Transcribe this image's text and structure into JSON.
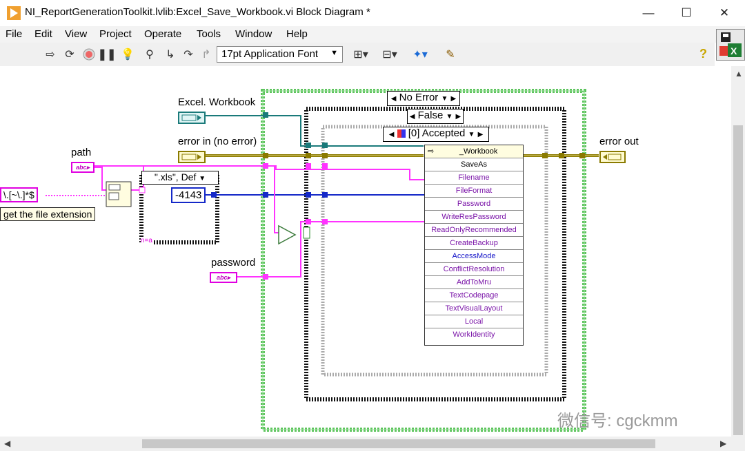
{
  "window": {
    "title": "NI_ReportGenerationToolkit.lvlib:Excel_Save_Workbook.vi Block Diagram *",
    "controls": {
      "minimize": "—",
      "maximize": "☐",
      "close": "✕"
    }
  },
  "menu": [
    "File",
    "Edit",
    "View",
    "Project",
    "Operate",
    "Tools",
    "Window",
    "Help"
  ],
  "toolbar": {
    "font_select": "17pt Application Font",
    "icons": [
      "run-arrow-icon",
      "run-continuously-icon",
      "abort-icon",
      "pause-icon",
      "highlight-execution-icon",
      "retain-wire-values-icon",
      "step-into-icon",
      "step-over-icon",
      "step-out-icon",
      "align-objects-icon",
      "distribute-objects-icon",
      "reorder-icon",
      "cleanup-diagram-icon"
    ],
    "help": "?"
  },
  "diagram": {
    "labels": {
      "excel_workbook": "Excel. Workbook",
      "error_in": "error in (no error)",
      "error_out": "error out",
      "path": "path",
      "password": "password"
    },
    "regex_constant": "\\.[~\\.]*$",
    "comment": "get the file extension",
    "inner_case_selector": "\".xls\", Def",
    "numeric_constant": "-4143",
    "error_case_selector": "No Error",
    "bool_case_selector": "False",
    "event_case_selector": "[0] Accepted",
    "index_label": "n=a",
    "invoke_node": {
      "class": "_Workbook",
      "method": "SaveAs",
      "params": [
        {
          "name": "Filename",
          "style": "purple"
        },
        {
          "name": "FileFormat",
          "style": "purple"
        },
        {
          "name": "Password",
          "style": "purple"
        },
        {
          "name": "WriteResPassword",
          "style": "purple"
        },
        {
          "name": "ReadOnlyRecommended",
          "style": "purple"
        },
        {
          "name": "CreateBackup",
          "style": "purple"
        },
        {
          "name": "AccessMode",
          "style": "blue"
        },
        {
          "name": "ConflictResolution",
          "style": "purple"
        },
        {
          "name": "AddToMru",
          "style": "purple"
        },
        {
          "name": "TextCodepage",
          "style": "purple"
        },
        {
          "name": "TextVisualLayout",
          "style": "purple"
        },
        {
          "name": "Local",
          "style": "purple"
        },
        {
          "name": "WorkIdentity",
          "style": "purple"
        }
      ]
    },
    "colors": {
      "string_wire": "#ff33ff",
      "numeric_wire": "#1428c8",
      "error_wire": "#8a7a00",
      "refnum_wire": "#1a7a7a",
      "structure_green": "#5cc45c"
    }
  },
  "watermark": "微信号: cgckmm"
}
